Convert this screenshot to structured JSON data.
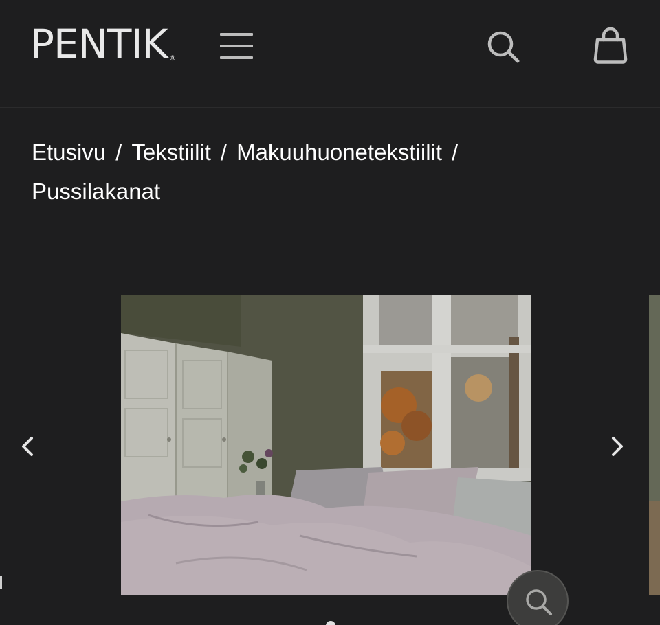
{
  "header": {
    "logo_text": "PENTIK",
    "logo_mark": "®",
    "menu_icon": "hamburger-menu-icon",
    "search_icon": "search-icon",
    "cart_icon": "shopping-bag-icon"
  },
  "breadcrumb": {
    "items": [
      "Etusivu",
      "Tekstiilit",
      "Makuuhuonetekstiilit",
      "Pussilakanat"
    ],
    "separator": "/"
  },
  "gallery": {
    "image_alt": "Pussilakanat",
    "prev_icon": "chevron-left-icon",
    "next_icon": "chevron-right-icon",
    "zoom_icon": "zoom-search-icon"
  },
  "colors": {
    "background": "#1e1e1f",
    "text": "#ffffff",
    "icon": "#bdbdbd"
  }
}
